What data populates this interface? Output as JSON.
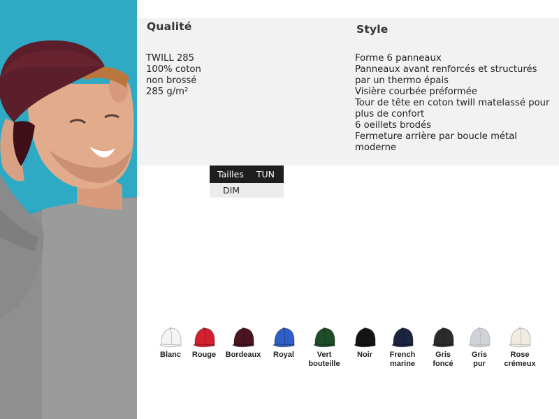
{
  "quality": {
    "heading": "Qualité",
    "lines": [
      "TWILL 285",
      "100% coton",
      "non brossé",
      "285 g/m²"
    ]
  },
  "style": {
    "heading": "Style",
    "lines": [
      "Forme 6 panneaux",
      "Panneaux avant renforcés et structurés par un thermo épais",
      "Visière courbée préformée",
      "Tour de tête en coton twill matelassé pour plus de confort",
      "6 oeillets brodés",
      "Fermeture arrière par boucle métal moderne"
    ]
  },
  "sizes": {
    "header_label": "Tailles",
    "header_value": "TUN",
    "row_label": "DIM"
  },
  "colors": [
    {
      "name": "Blanc",
      "hex": "#f4f4f4"
    },
    {
      "name": "Rouge",
      "hex": "#d4202f"
    },
    {
      "name": "Bordeaux",
      "hex": "#4a1420"
    },
    {
      "name": "Royal",
      "hex": "#2f5ec8"
    },
    {
      "name": "Vert bouteille",
      "hex": "#1f4d2a"
    },
    {
      "name": "Noir",
      "hex": "#141414"
    },
    {
      "name": "French marine",
      "hex": "#1c2540"
    },
    {
      "name": "Gris foncé",
      "hex": "#2b2b2b"
    },
    {
      "name": "Gris pur",
      "hex": "#cfd3d8"
    },
    {
      "name": "Rose crémeux",
      "hex": "#f1ece2"
    }
  ]
}
